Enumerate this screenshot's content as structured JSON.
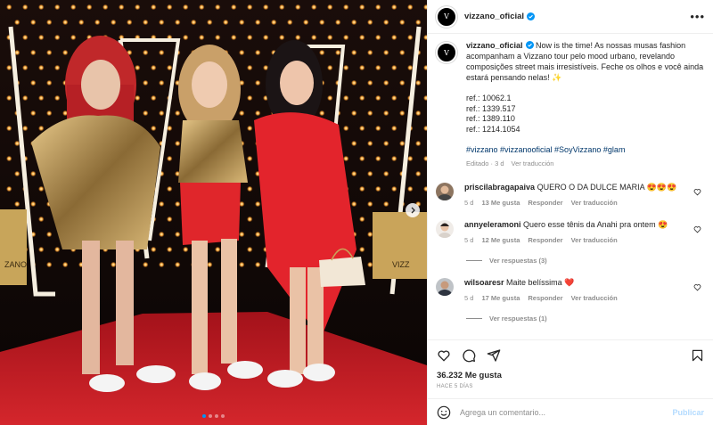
{
  "account": {
    "username": "vizzano_oficial",
    "avatar_letter": "V"
  },
  "header": {
    "more_label": "•••"
  },
  "caption": {
    "text": " Now is the time! As nossas musas fashion acompanham a Vizzano tour pelo mood urbano, revelando composições street mais irresistíveis. Feche os olhos e você ainda estará pensando nelas! ✨",
    "refs": [
      "ref.: 10062.1",
      "ref.: 1339.517",
      "ref.: 1389.110",
      "ref.: 1214.1054"
    ],
    "hashtags": "#vizzano #vizzanooficial #SoyVizzano #glam",
    "edited": "Editado · 3 d",
    "translate": "Ver traducción"
  },
  "comments": [
    {
      "user": "priscilabragapaiva",
      "text": "QUERO O DA DULCE MARIA 😍😍😍",
      "age": "5 d",
      "likes": "13 Me gusta",
      "reply": "Responder",
      "translate": "Ver traducción",
      "replies": ""
    },
    {
      "user": "annyeleramoni",
      "text": "Quero esse tênis da Anahi pra ontem 😍",
      "age": "5 d",
      "likes": "12 Me gusta",
      "reply": "Responder",
      "translate": "Ver traducción",
      "replies": "Ver respuestas (3)"
    },
    {
      "user": "wilsoaresr",
      "text": "Maite belíssima ❤️",
      "age": "5 d",
      "likes": "17 Me gusta",
      "reply": "Responder",
      "translate": "Ver traducción",
      "replies": "Ver respuestas (1)"
    }
  ],
  "stats": {
    "likes": "36.232 Me gusta",
    "time_ago": "HACE 5 DÍAS"
  },
  "add_comment": {
    "placeholder": "Agrega un comentario...",
    "post_label": "Publicar"
  },
  "colors": {
    "accent": "#0095f6",
    "link": "#00376b",
    "muted": "#8e8e8e",
    "like_red": "#ed4956",
    "carpet": "#c8151b"
  },
  "icons": [
    "verified-badge-icon",
    "more-options-icon",
    "heart-icon",
    "comment-icon",
    "share-icon",
    "bookmark-icon",
    "emoji-icon",
    "chevron-right-icon"
  ],
  "carousel": {
    "slides": 4,
    "active": 1
  }
}
